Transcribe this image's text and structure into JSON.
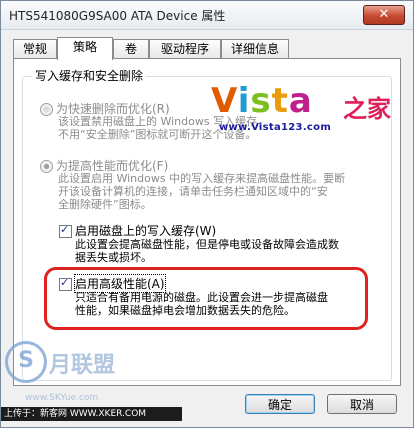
{
  "window": {
    "title": "HTS541080G9SA00 ATA Device 属性",
    "close_glyph": "✕"
  },
  "tabs": [
    {
      "label": "常规"
    },
    {
      "label": "策略"
    },
    {
      "label": "卷"
    },
    {
      "label": "驱动程序"
    },
    {
      "label": "详细信息"
    }
  ],
  "group": {
    "title": "写入缓存和安全删除"
  },
  "options": {
    "quick_removal": {
      "label": "为快速删除而优化(R)",
      "desc": [
        "该设置禁用磁盘上的 Windows 写入缓存，",
        "不用“安全删除”图标就可断开这个设备。"
      ]
    },
    "performance": {
      "label": "为提高性能而优化(F)",
      "desc": [
        "此设置启用 Windows 中的写入缓存来提高磁盘性能。要断",
        "开该设备计算机的连接，请单击任务栏通知区域中的“安",
        "全删除硬件”图标。"
      ]
    },
    "write_cache": {
      "label": "启用磁盘上的写入缓存(W)",
      "desc": [
        "此设置会提高磁盘性能，但是停电或设备故障会造成数",
        "据丢失或损坏。"
      ]
    },
    "advanced_perf": {
      "label": "启用高级性能(A)",
      "desc": [
        "只适合有备用电源的磁盘。此设置会进一步提高磁盘",
        "性能，如果磁盘掉电会增加数据丢失的危险。"
      ]
    }
  },
  "logo": {
    "brand_letters": [
      "V",
      "i",
      "s",
      "t",
      "a"
    ],
    "brand_suffix": "之家",
    "url": "www.Vista123.com"
  },
  "watermark": {
    "glyph": "S",
    "text": "月联盟",
    "url": "www.SKYue.com"
  },
  "buttons": {
    "ok": "确定",
    "cancel": "取消"
  },
  "status_bar": {
    "text": "上传于：新客网 WWW.XKER.COM"
  }
}
